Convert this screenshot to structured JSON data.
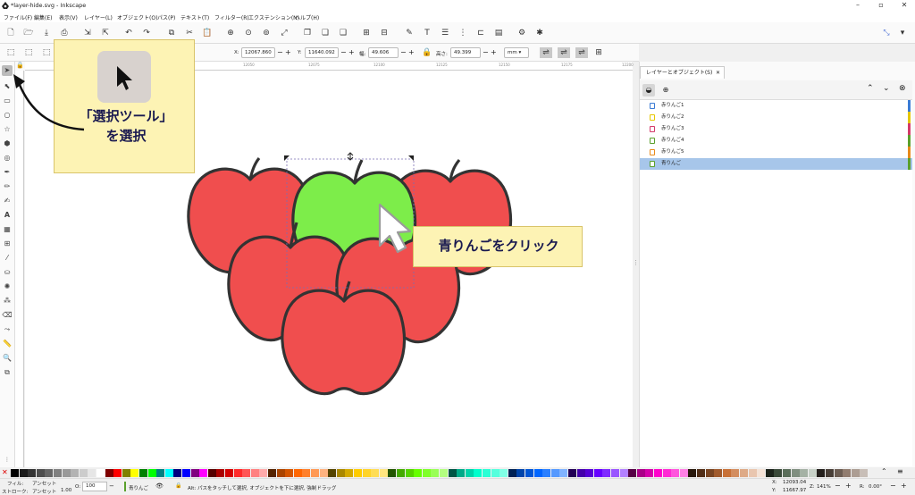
{
  "window": {
    "title": "*layer-hide.svg - Inkscape",
    "min": "–",
    "max": "▫",
    "close": "✕"
  },
  "menu": [
    "ファイル(F)",
    "編集(E)",
    "表示(V)",
    "レイヤー(L)",
    "オブジェクト(O)",
    "パス(P)",
    "テキスト(T)",
    "フィルター(R)",
    "エクステンション(N)",
    "ヘルプ(H)"
  ],
  "controls": {
    "x_label": "X:",
    "x_value": "12067.860",
    "y_label": "Y:",
    "y_value": "11640.092",
    "w_label": "幅:",
    "w_value": "49.606",
    "h_label": "高さ:",
    "h_value": "49.399",
    "unit": "mm"
  },
  "ruler": [
    "12050",
    "12075",
    "12100",
    "12125",
    "12150",
    "12175",
    "12200"
  ],
  "panel": {
    "tab_label": "レイヤーとオブジェクト(S)",
    "objects": [
      {
        "label": "赤りんご1",
        "color": "#3a7bd5",
        "selected": false
      },
      {
        "label": "赤りんご2",
        "color": "#e6c700",
        "selected": false
      },
      {
        "label": "赤りんご3",
        "color": "#d43a6a",
        "selected": false
      },
      {
        "label": "赤りんご4",
        "color": "#5aa02c",
        "selected": false
      },
      {
        "label": "赤りんご5",
        "color": "#e88a1a",
        "selected": false
      },
      {
        "label": "青りんご",
        "color": "#5aa02c",
        "selected": true
      }
    ]
  },
  "callouts": {
    "select_tool": "「選択ツール」\nを選択",
    "click_green": "青りんごをクリック"
  },
  "status": {
    "fill_label": "フィル:",
    "fill_value": "アンセット",
    "stroke_label": "ストローク:",
    "stroke_value": "アンセット",
    "stroke_width": "1.00",
    "opacity_label": "O:",
    "opacity_value": "100",
    "layer": "青りんご",
    "message": "Alt: パスをタッチして選択, オブジェクトを下に選択, 強制ドラッグ",
    "x_label": "X:",
    "x_value": "12093.04",
    "y_label": "Y:",
    "y_value": "11667.97",
    "zoom_label": "Z:",
    "zoom_value": "141%",
    "rot_label": "R:",
    "rot_value": "0.00°"
  },
  "colors": {
    "apple_red": "#f04e4e",
    "apple_green": "#7ded4a",
    "outline": "#333333",
    "callout": "#fdf3b4",
    "palette": [
      "#000000",
      "#1a1a1a",
      "#333333",
      "#4d4d4d",
      "#666666",
      "#808080",
      "#999999",
      "#b3b3b3",
      "#cccccc",
      "#e6e6e6",
      "#ffffff",
      "#800000",
      "#ff0000",
      "#808000",
      "#ffff00",
      "#008000",
      "#00ff00",
      "#008080",
      "#00ffff",
      "#000080",
      "#0000ff",
      "#800080",
      "#ff00ff",
      "#550000",
      "#aa0000",
      "#d40000",
      "#ff2a2a",
      "#ff5555",
      "#ff8080",
      "#ffaaaa",
      "#552200",
      "#aa4400",
      "#d45500",
      "#ff6600",
      "#ff7f2a",
      "#ff9955",
      "#ffb380",
      "#554400",
      "#aa8800",
      "#d4aa00",
      "#ffcc00",
      "#ffd42a",
      "#ffdd55",
      "#ffe680",
      "#225500",
      "#44aa00",
      "#55d400",
      "#66ff00",
      "#7fff2a",
      "#99ff55",
      "#b3ff80",
      "#005544",
      "#00aa88",
      "#00d4aa",
      "#00ffcc",
      "#2affd5",
      "#55ffdd",
      "#80ffe6",
      "#002255",
      "#0044aa",
      "#0055d4",
      "#0066ff",
      "#2a7fff",
      "#5599ff",
      "#80b3ff",
      "#220055",
      "#4400aa",
      "#5500d4",
      "#6600ff",
      "#7f2aff",
      "#9955ff",
      "#b380ff",
      "#550044",
      "#aa0088",
      "#d400aa",
      "#ff00cc",
      "#ff2ad4",
      "#ff55dd",
      "#ff80e5",
      "#28170b",
      "#502d16",
      "#784421",
      "#a05a2c",
      "#c87137",
      "#d38d5f",
      "#deaa87",
      "#e9c6af",
      "#f4e3d7",
      "#1c241c",
      "#3a4a3a",
      "#5a6e5a",
      "#808f80",
      "#a5b2a5",
      "#c8d1c8",
      "#241f1c",
      "#483e37",
      "#6c5d53",
      "#917c6f",
      "#ac9d93",
      "#c8beb7",
      "#e3dedb"
    ]
  }
}
